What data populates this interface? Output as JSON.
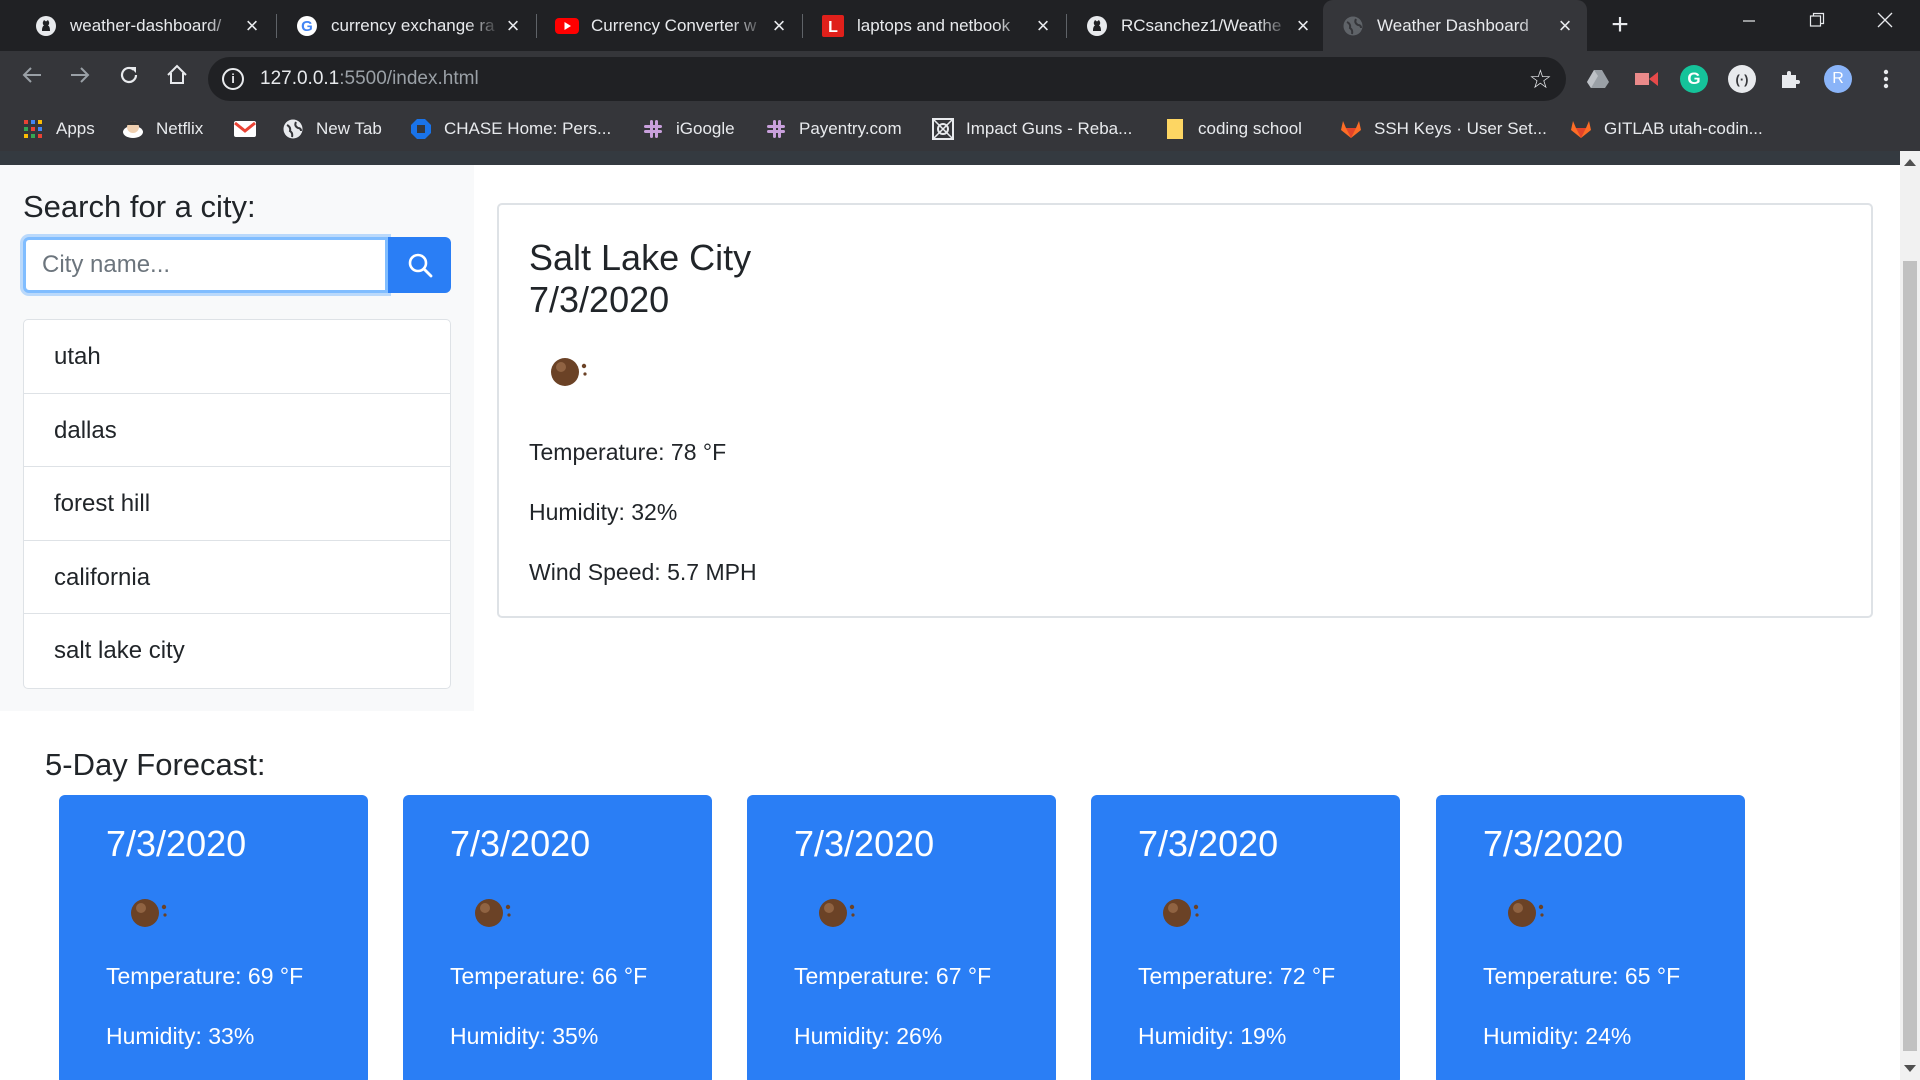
{
  "browser": {
    "tabs": [
      {
        "title": "weather-dashboard/",
        "icon": "github-icon"
      },
      {
        "title": "currency exchange ra",
        "icon": "google-icon"
      },
      {
        "title": "Currency Converter w",
        "icon": "youtube-icon"
      },
      {
        "title": "laptops and netbook",
        "icon": "l-icon"
      },
      {
        "title": "RCsanchez1/Weathe",
        "icon": "github-icon"
      },
      {
        "title": "Weather Dashboard",
        "icon": "globe-icon",
        "active": true
      }
    ],
    "url_host": "127.0.0.1",
    "url_rest": ":5500/index.html",
    "bookmarks": [
      {
        "label": "Apps",
        "icon": "apps-grid-icon"
      },
      {
        "label": "Netflix",
        "icon": "netflix-icon"
      },
      {
        "label": "",
        "icon": "gmail-icon"
      },
      {
        "label": "New Tab",
        "icon": "globe-icon"
      },
      {
        "label": "CHASE Home: Pers...",
        "icon": "chase-icon"
      },
      {
        "label": "iGoogle",
        "icon": "slack-icon"
      },
      {
        "label": "Payentry.com",
        "icon": "slack-icon"
      },
      {
        "label": "Impact Guns - Reba...",
        "icon": "impact-icon"
      },
      {
        "label": "coding school",
        "icon": "folder-icon"
      },
      {
        "label": "SSH Keys · User Set...",
        "icon": "gitlab-icon"
      },
      {
        "label": "GITLAB utah-codin...",
        "icon": "gitlab-icon"
      }
    ],
    "profile_initial": "R"
  },
  "sidebar": {
    "heading": "Search for a city:",
    "search_placeholder": "City name...",
    "history": [
      "utah",
      "dallas",
      "forest hill",
      "california",
      "salt lake city"
    ]
  },
  "current": {
    "city": "Salt Lake City",
    "date": "7/3/2020",
    "temperature": "Temperature: 78 °F",
    "humidity": "Humidity: 32%",
    "wind": "Wind Speed: 5.7 MPH"
  },
  "forecast": {
    "heading": "5-Day Forecast:",
    "days": [
      {
        "date": "7/3/2020",
        "temperature": "Temperature: 69 °F",
        "humidity": "Humidity: 33%"
      },
      {
        "date": "7/3/2020",
        "temperature": "Temperature: 66 °F",
        "humidity": "Humidity: 35%"
      },
      {
        "date": "7/3/2020",
        "temperature": "Temperature: 67 °F",
        "humidity": "Humidity: 26%"
      },
      {
        "date": "7/3/2020",
        "temperature": "Temperature: 72 °F",
        "humidity": "Humidity: 19%"
      },
      {
        "date": "7/3/2020",
        "temperature": "Temperature: 65 °F",
        "humidity": "Humidity: 24%"
      }
    ]
  },
  "colors": {
    "accent": "#2a7ef5",
    "chrome_dark": "#202124",
    "chrome_toolbar": "#35363a"
  }
}
